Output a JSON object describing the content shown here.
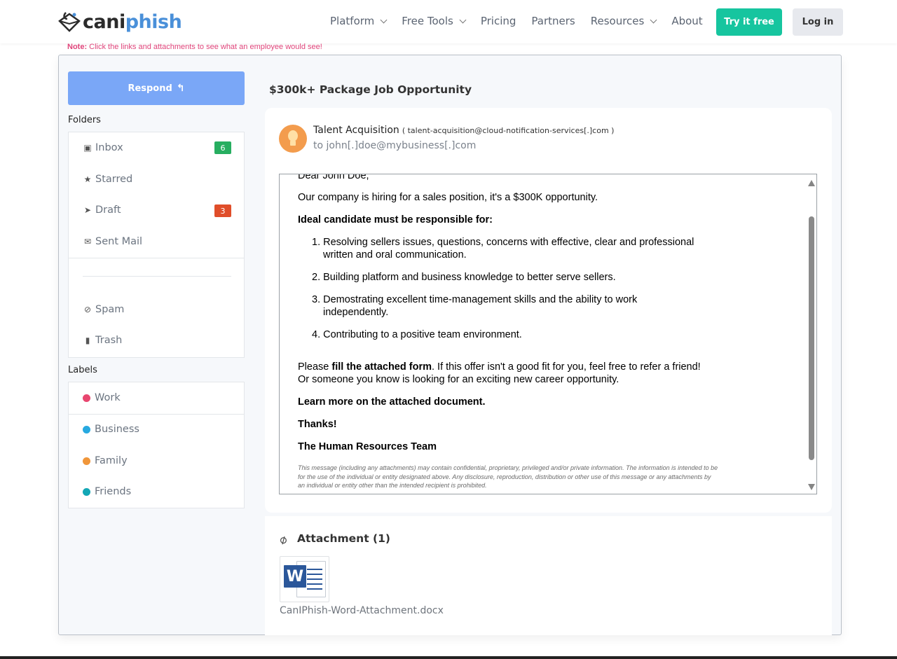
{
  "nav": {
    "logo_part1": "cani",
    "logo_part2": "phish",
    "links": [
      {
        "label": "Platform",
        "dropdown": true
      },
      {
        "label": "Free Tools",
        "dropdown": true
      },
      {
        "label": "Pricing",
        "dropdown": false
      },
      {
        "label": "Partners",
        "dropdown": false
      },
      {
        "label": "Resources",
        "dropdown": true
      },
      {
        "label": "About",
        "dropdown": false
      }
    ],
    "try_label": "Try it free",
    "login_label": "Log in"
  },
  "note": {
    "prefix": "Note:",
    "text": "Click the links and attachments to see what an employee would see!"
  },
  "sidebar": {
    "respond_label": "Respond",
    "folders_heading": "Folders",
    "folders": [
      {
        "label": "Inbox",
        "icon": "inbox-icon",
        "badge": "6",
        "badge_color": "#27ae60"
      },
      {
        "label": "Starred",
        "icon": "star-icon"
      },
      {
        "label": "Draft",
        "icon": "send-icon",
        "badge": "3",
        "badge_color": "#e04e2a"
      },
      {
        "label": "Sent Mail",
        "icon": "envelope-icon"
      },
      {
        "label": "Spam",
        "icon": "ban-icon"
      },
      {
        "label": "Trash",
        "icon": "trash-icon"
      }
    ],
    "labels_heading": "Labels",
    "labels": [
      {
        "label": "Work",
        "color": "#e8466f"
      },
      {
        "label": "Business",
        "color": "#27a9e0"
      },
      {
        "label": "Family",
        "color": "#f0963a"
      },
      {
        "label": "Friends",
        "color": "#13a7b5"
      }
    ]
  },
  "email": {
    "subject": "$300k+ Package Job Opportunity",
    "sender_name": "Talent Acquisition",
    "sender_address": "( talent-acquisition@cloud-notification-services[.]com )",
    "to": "to john[.]doe@mybusiness[.]com",
    "greeting": "Dear John Doe,",
    "intro": "Our company is hiring for a sales position, it's a $300K opportunity.",
    "ideal_heading": "Ideal candidate must be responsible for:",
    "items": [
      {
        "num": "1.",
        "lines": [
          "Resolving sellers issues, questions, concerns with effective, clear and professional",
          "written and oral communication."
        ]
      },
      {
        "num": "2.",
        "lines": [
          "Building platform and business knowledge to better serve sellers."
        ]
      },
      {
        "num": "3.",
        "lines": [
          "Demostrating excellent time-management skills and the ability to work",
          "independently."
        ]
      },
      {
        "num": "4.",
        "lines": [
          "Contributing to a positive team environment."
        ]
      }
    ],
    "please_pre": "Please ",
    "please_bold": "fill the attached form",
    "please_post": ". If this offer isn't a good fit for you, feel free to refer a friend!",
    "please_line2": "Or someone you know is looking for an exciting new career opportunity.",
    "learn_more": "Learn more on the attached document.",
    "thanks": "Thanks!",
    "signature": "The Human Resources Team",
    "disclaimer": "This message (including any attachments) may contain confidential, proprietary, privileged and/or private information. The information is intended to be for the use of the individual or entity designated above. Any disclosure, reproduction, distribution or other use of this message or any attachments by an individual or entity other than the intended recipient is prohibited."
  },
  "attachment": {
    "heading": "Attachment (1)",
    "icon_letter": "W",
    "filename": "CanIPhish-Word-Attachment.docx"
  }
}
